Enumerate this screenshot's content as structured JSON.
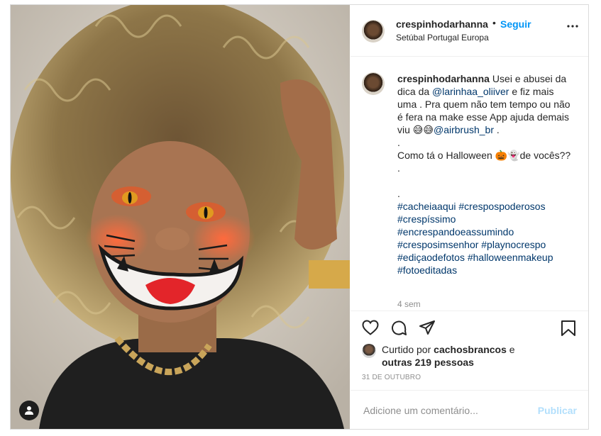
{
  "post": {
    "username": "crespinhodarhanna",
    "header_dot": "•",
    "follow_label": "Seguir",
    "location": "Setúbal Portugal Europa",
    "more_icon": "more-horizontal-icon"
  },
  "caption": {
    "username": "crespinhodarhanna",
    "text_1": "Usei e abusei da dica da ",
    "mention_1": "@larinhaa_oliiver",
    "text_2": " e fiz mais uma . Pra quem não tem tempo ou não é fera na make esse App ajuda demais viu 😅😅",
    "mention_2": "@airbrush_br",
    "text_3": " .",
    "dot_1": ".",
    "line_halloween": "Como tá o Halloween 🎃👻de vocês??",
    "dot_2": ".",
    "dot_3": ".",
    "hashtag_lines": [
      "#cacheiaaqui #crespospoderosos",
      "#crespíssimo",
      "#encrespandoeassumindo",
      "#cresposimsenhor #playnocrespo",
      "#ediçaodefotos #halloweenmakeup",
      "#fotoeditadas"
    ],
    "time": "4 sem"
  },
  "actions": {
    "like_icon": "heart-icon",
    "comment_icon": "comment-icon",
    "share_icon": "share-icon",
    "save_icon": "bookmark-icon"
  },
  "likes": {
    "prefix": "Curtido por ",
    "liker": "cachosbrancos",
    "suffix": " e",
    "others": "outras 219 pessoas"
  },
  "date": "31 DE OUTUBRO",
  "comment_box": {
    "placeholder": "Adicione um comentário...",
    "publish_label": "Publicar"
  },
  "colors": {
    "link": "#00376b",
    "follow": "#0095f6",
    "publish_disabled": "#b2dffc",
    "muted": "#8e8e8e"
  }
}
